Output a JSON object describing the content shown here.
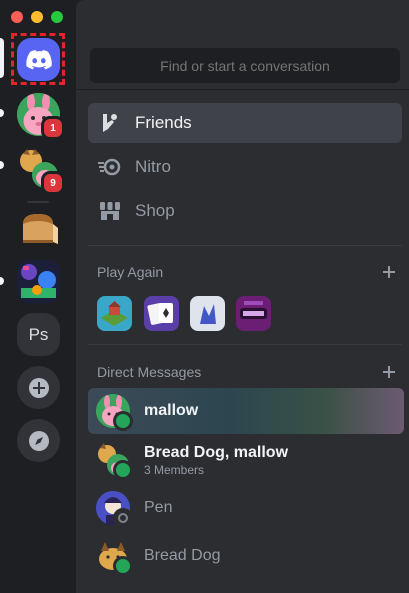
{
  "window": {
    "traffic_lights": [
      "#ff5f57",
      "#febc2e",
      "#28c840"
    ]
  },
  "servers": [
    {
      "name": "direct-messages-home",
      "icon": "discord-logo-icon",
      "selected": true,
      "color": "#5865f2"
    },
    {
      "name": "pink-bunny-server",
      "badge": "1"
    },
    {
      "name": "bread-dog-group",
      "badge": "9"
    },
    {
      "name": "bread-server"
    },
    {
      "name": "game-art-server"
    },
    {
      "name": "ps-server",
      "label": "Ps"
    },
    {
      "name": "add-server",
      "icon": "plus-circle-icon"
    },
    {
      "name": "explore-servers",
      "icon": "compass-icon"
    }
  ],
  "search": {
    "placeholder": "Find or start a conversation"
  },
  "nav": [
    {
      "label": "Friends",
      "icon": "friends-wave-icon",
      "active": true
    },
    {
      "label": "Nitro",
      "icon": "nitro-icon"
    },
    {
      "label": "Shop",
      "icon": "shop-icon"
    }
  ],
  "play_again": {
    "title": "Play Again",
    "add_icon": "plus-icon",
    "games": [
      "farm-game",
      "solitaire-game",
      "sketch-game",
      "chess-drone-game"
    ]
  },
  "direct_messages": {
    "title": "Direct Messages",
    "add_icon": "plus-icon",
    "items": [
      {
        "name": "mallow",
        "status": "online",
        "active": true
      },
      {
        "name": "Bread Dog, mallow",
        "subtitle": "3 Members",
        "status": "online"
      },
      {
        "name": "Pen",
        "status": "offline"
      },
      {
        "name": "Bread Dog",
        "status": "online"
      }
    ]
  },
  "colors": {
    "accent": "#5865f2",
    "badge": "#da373c",
    "online": "#23a55a",
    "selection_outline": "#e3242b"
  }
}
